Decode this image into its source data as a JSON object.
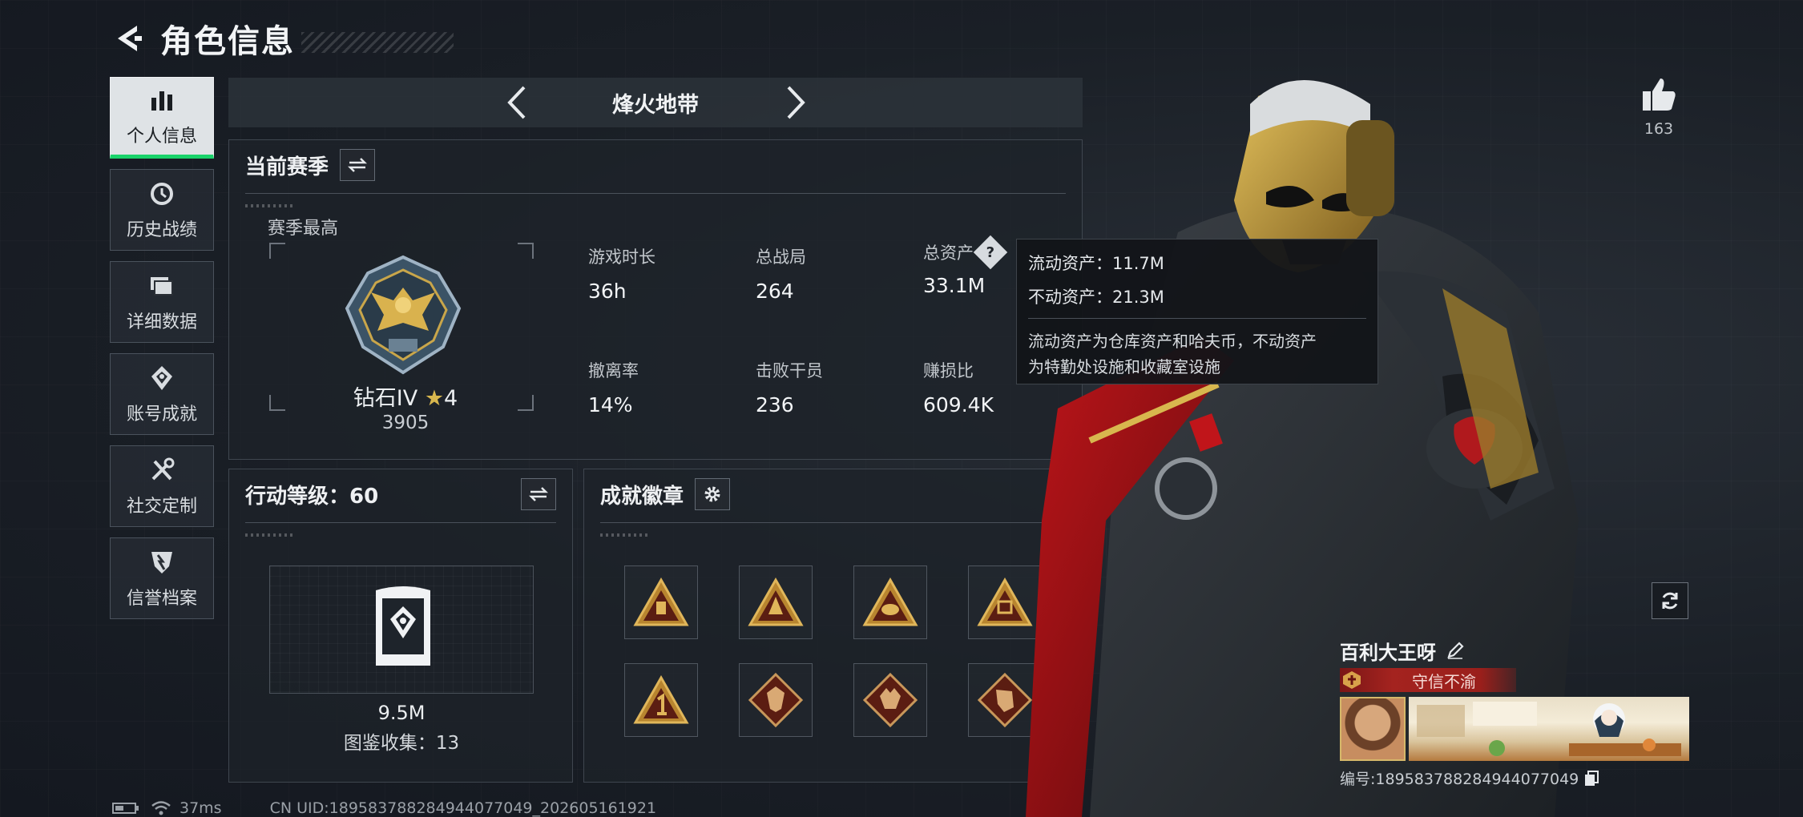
{
  "header": {
    "title": "角色信息"
  },
  "sidebar": {
    "items": [
      {
        "label": "个人信息",
        "icon": "bar-chart-icon",
        "active": true
      },
      {
        "label": "历史战绩",
        "icon": "history-clock-icon",
        "active": false
      },
      {
        "label": "详细数据",
        "icon": "folder-data-icon",
        "active": false
      },
      {
        "label": "账号成就",
        "icon": "achievement-icon",
        "active": false
      },
      {
        "label": "社交定制",
        "icon": "tools-icon",
        "active": false
      },
      {
        "label": "信誉档案",
        "icon": "credit-shield-icon",
        "active": false
      }
    ]
  },
  "mode": {
    "name": "烽火地带"
  },
  "season": {
    "title": "当前赛季",
    "best_label": "赛季最高",
    "rank_name": "钻石IV",
    "rank_stars": "4",
    "rank_score": "3905",
    "stats": [
      {
        "label": "游戏时长",
        "value": "36h"
      },
      {
        "label": "总战局",
        "value": "264"
      },
      {
        "label": "总资产",
        "value": "33.1M"
      },
      {
        "label": "撤离率",
        "value": "14%"
      },
      {
        "label": "击败干员",
        "value": "236"
      },
      {
        "label": "赚损比",
        "value": "609.4K"
      }
    ]
  },
  "tooltip": {
    "liquid": "流动资产：11.7M",
    "fixed": "不动资产：21.3M",
    "desc1": "流动资产为仓库资产和哈夫币，不动资产",
    "desc2": "为特勤处设施和收藏室设施"
  },
  "level": {
    "title": "行动等级：60",
    "value": "9.5M",
    "collect": "图鉴收集：13"
  },
  "badges": {
    "title": "成就徽章"
  },
  "profile": {
    "likes": "163",
    "name": "百利大王呀",
    "honor": "守信不渝",
    "id": "编号:18958378828494407704​9"
  },
  "footer": {
    "ping": "37ms",
    "uid": "CN UID:18958378828494407704​9_202605161921"
  },
  "colors": {
    "accent_green": "#19d36a",
    "gold": "#d8b74e",
    "honor_red": "#a4231f"
  }
}
